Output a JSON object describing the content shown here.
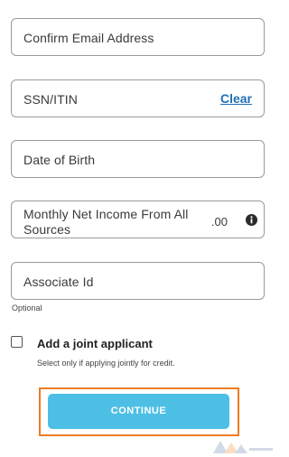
{
  "form": {
    "confirm_email": {
      "placeholder": "Confirm Email Address"
    },
    "ssn": {
      "placeholder": "SSN/ITIN",
      "clear_label": "Clear"
    },
    "dob": {
      "placeholder": "Date of Birth"
    },
    "income": {
      "placeholder": "Monthly Net Income From All Sources",
      "cents": ".00",
      "info_icon": "info-icon"
    },
    "associate_id": {
      "placeholder": "Associate Id",
      "hint": "Optional"
    },
    "joint": {
      "label": "Add a joint applicant",
      "hint": "Select only if applying jointly for credit.",
      "checked": false
    },
    "continue_label": "CONTINUE"
  },
  "colors": {
    "accent": "#4dbfe4",
    "link": "#1f6fb5",
    "highlight_outline": "#f07b21",
    "field_border": "#9a9a9a"
  }
}
